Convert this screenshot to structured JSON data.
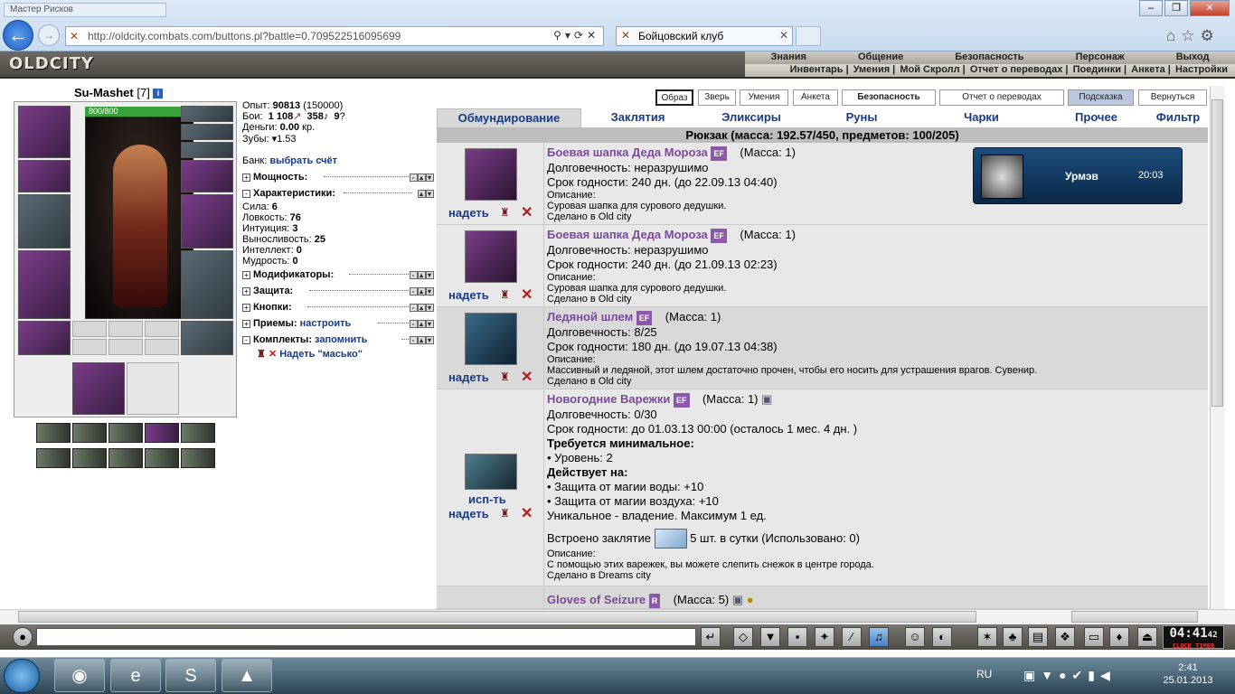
{
  "browser": {
    "old_tab": "Мастер Рисков",
    "url": "http://oldcity.combats.com/buttons.pl?battle=0.709522516095699",
    "tab_title": "Бойцовский клуб"
  },
  "game": {
    "logo": "OLDCITY",
    "main_menu": [
      "Знания",
      "Общение",
      "Безопасность",
      "Персонаж",
      "Выход"
    ],
    "sub_menu": [
      "Инвентарь",
      "Умения",
      "Мой Скролл",
      "Отчет о переводах",
      "Поединки",
      "Анкета",
      "Настройки"
    ]
  },
  "character": {
    "name": "Su-Mashet",
    "level": "[7]",
    "hp": "800/800"
  },
  "stats": {
    "exp_label": "Опыт:",
    "exp_value": "90813",
    "exp_next": "(150000)",
    "fights_label": "Бои:",
    "fights_win": "1 108",
    "fights_loss": "358",
    "fights_draw": "9",
    "money_label": "Деньги:",
    "money_value": "0.00",
    "money_unit": "кр.",
    "teeth_label": "Зубы:",
    "teeth_value": "1.53",
    "bank_label": "Банк:",
    "bank_link": "выбрать счёт"
  },
  "sections": {
    "power": "Мощность:",
    "characteristics": "Характеристики:",
    "modifiers": "Модификаторы:",
    "defense": "Защита:",
    "buttons": "Кнопки:",
    "techniques": "Приемы:",
    "techniques_link": "настроить",
    "sets": "Комплекты:",
    "sets_link": "запомнить",
    "set_item": "Надеть \"масько\""
  },
  "attributes": [
    {
      "label": "Сила:",
      "value": "6"
    },
    {
      "label": "Ловкость:",
      "value": "76"
    },
    {
      "label": "Интуиция:",
      "value": "3"
    },
    {
      "label": "Выносливость:",
      "value": "25"
    },
    {
      "label": "Интеллект:",
      "value": "0"
    },
    {
      "label": "Мудрость:",
      "value": "0"
    }
  ],
  "top_buttons": [
    "Образ",
    "Зверь",
    "Умения",
    "Анкета",
    "Безопасность",
    "Отчет о переводах",
    "Подсказка",
    "Вернуться"
  ],
  "tabs": [
    "Обмундирование",
    "Заклятия",
    "Эликсиры",
    "Руны",
    "Чарки",
    "Прочее",
    "Фильтр"
  ],
  "backpack_header": "Рюкзак (масса: 192.57/450, предметов: 100/205)",
  "notification": {
    "name": "Урмэв",
    "time": "20:03"
  },
  "actions": {
    "wear": "надеть",
    "use": "исп-ть"
  },
  "items": [
    {
      "name": "Боевая шапка Деда Мороза",
      "badge": "EF",
      "mass": "(Масса: 1)",
      "durability": "Долговечность: неразрушимо",
      "expiry": "Срок годности: 240 дн. (до 22.09.13 04:40)",
      "desc_label": "Описание:",
      "desc": "Суровая шапка для сурового дедушки.",
      "made": "Сделано в Old city"
    },
    {
      "name": "Боевая шапка Деда Мороза",
      "badge": "EF",
      "mass": "(Масса: 1)",
      "durability": "Долговечность: неразрушимо",
      "expiry": "Срок годности: 240 дн. (до 21.09.13 02:23)",
      "desc_label": "Описание:",
      "desc": "Суровая шапка для сурового дедушки.",
      "made": "Сделано в Old city"
    },
    {
      "name": "Ледяной шлем",
      "badge": "EF",
      "mass": "(Масса: 1)",
      "durability": "Долговечность: 8/25",
      "expiry": "Срок годности: 180 дн. (до 19.07.13 04:38)",
      "desc_label": "Описание:",
      "desc": "Массивный и ледяной, этот шлем достаточно прочен, чтобы его носить для устрашения врагов. Сувенир.",
      "made": "Сделано в Old city"
    },
    {
      "name": "Новогодние Варежки",
      "badge": "EF",
      "mass": "(Масса: 1)",
      "durability": "Долговечность: 0/30",
      "expiry": "Срок годности: до 01.03.13 00:00 (осталось 1 мес. 4 дн. )",
      "req_title": "Требуется минимальное:",
      "req_level": "• Уровень: 2",
      "effect_title": "Действует на:",
      "effect_1": "• Защита от магии воды: +10",
      "effect_2": "• Защита от магии воздуха: +10",
      "unique": "Уникальное - владение. Максимум 1 ед.",
      "spell_label": "Встроено заклятие",
      "spell_info": "5 шт. в сутки (Использовано: 0)",
      "desc_label": "Описание:",
      "desc": "С помощью этих варежек, вы можете слепить снежок в центре города.",
      "made": "Сделано в Dreams city"
    },
    {
      "name": "Gloves of Seizure",
      "badge": "R",
      "mass": "(Масса: 5)"
    }
  ],
  "clock": {
    "time": "04:41",
    "seconds": "42",
    "labels": "CLOCK TIMER"
  },
  "taskbar": {
    "lang": "RU",
    "time": "2:41",
    "date": "25.01.2013"
  }
}
